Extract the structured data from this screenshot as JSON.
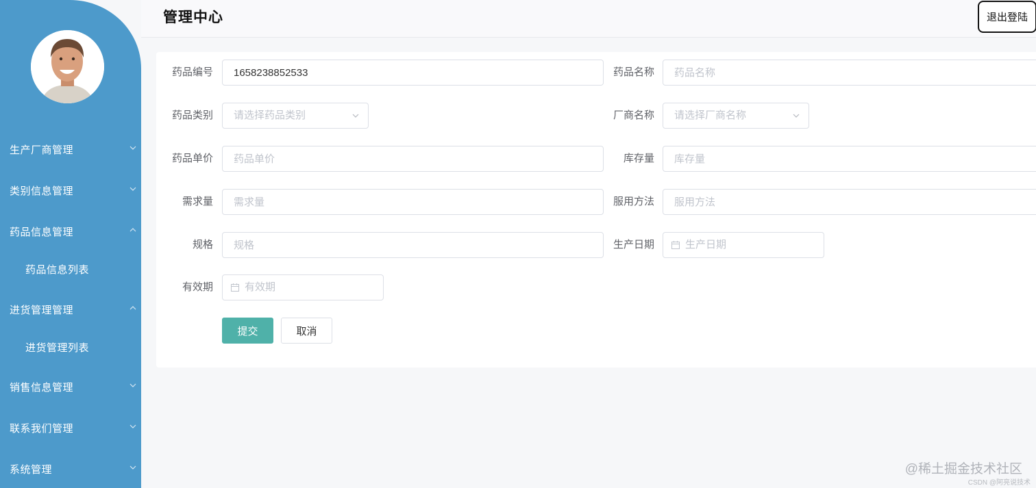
{
  "sidebar": {
    "menu": [
      {
        "label": "生产厂商管理",
        "chevron": "down"
      },
      {
        "label": "类别信息管理",
        "chevron": "down"
      },
      {
        "label": "药品信息管理",
        "chevron": "up"
      },
      {
        "label": "药品信息列表",
        "sub": true
      },
      {
        "label": "进货管理管理",
        "chevron": "up"
      },
      {
        "label": "进货管理列表",
        "sub": true
      },
      {
        "label": "销售信息管理",
        "chevron": "down"
      },
      {
        "label": "联系我们管理",
        "chevron": "down"
      },
      {
        "label": "系统管理",
        "chevron": "down"
      }
    ]
  },
  "header": {
    "title": "管理中心",
    "logout_label": "退出登陆"
  },
  "form": {
    "drug_code": {
      "label": "药品编号",
      "value": "1658238852533"
    },
    "drug_name": {
      "label": "药品名称",
      "placeholder": "药品名称"
    },
    "drug_category": {
      "label": "药品类别",
      "placeholder": "请选择药品类别"
    },
    "manufacturer": {
      "label": "厂商名称",
      "placeholder": "请选择厂商名称"
    },
    "unit_price": {
      "label": "药品单价",
      "placeholder": "药品单价"
    },
    "stock": {
      "label": "库存量",
      "placeholder": "库存量"
    },
    "demand": {
      "label": "需求量",
      "placeholder": "需求量"
    },
    "usage": {
      "label": "服用方法",
      "placeholder": "服用方法"
    },
    "spec": {
      "label": "规格",
      "placeholder": "规格"
    },
    "production_date": {
      "label": "生产日期",
      "placeholder": "生产日期"
    },
    "expiry": {
      "label": "有效期",
      "placeholder": "有效期"
    },
    "submit_label": "提交",
    "cancel_label": "取消"
  },
  "watermark": {
    "main": "@稀土掘金技术社区",
    "sub": "CSDN @阿亮说技术"
  },
  "colors": {
    "sidebar": "#4d9acb",
    "primary_button": "#4fb1a9"
  }
}
